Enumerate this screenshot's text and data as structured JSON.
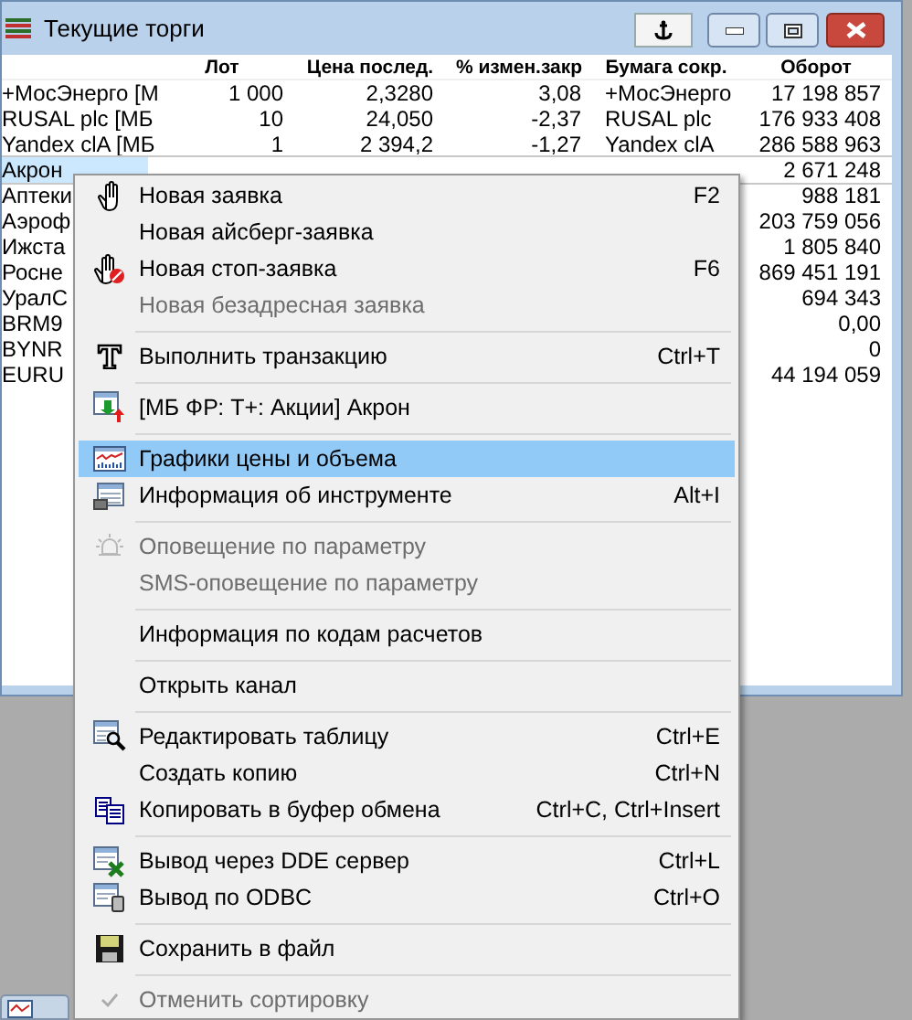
{
  "window": {
    "title": "Текущие торги"
  },
  "table": {
    "columns": [
      "",
      "Лот",
      "Цена послед.",
      "% измен.закр",
      "Бумага сокр.",
      "Оборот"
    ],
    "rows": [
      {
        "selected": false,
        "cells": [
          "+МосЭнерго [М",
          "1 000",
          "2,3280",
          "3,08",
          "+МосЭнерго",
          "17 198 857"
        ]
      },
      {
        "selected": false,
        "cells": [
          "RUSAL plc [МБ ",
          "10",
          "24,050",
          "-2,37",
          "RUSAL plc",
          "176 933 408"
        ]
      },
      {
        "selected": false,
        "cells": [
          "Yandex clA [МБ",
          "1",
          "2 394,2",
          "-1,27",
          "Yandex clA",
          "286 588 963"
        ]
      },
      {
        "selected": true,
        "cells": [
          "Акрон",
          "",
          "",
          "",
          "",
          "2 671 248"
        ]
      },
      {
        "selected": false,
        "cells": [
          "Аптеки",
          "",
          "",
          "",
          "",
          "988 181"
        ]
      },
      {
        "selected": false,
        "cells": [
          "Аэроф",
          "",
          "",
          "",
          "",
          "203 759 056"
        ]
      },
      {
        "selected": false,
        "cells": [
          "Ижста",
          "",
          "",
          "",
          "",
          "1 805 840"
        ]
      },
      {
        "selected": false,
        "cells": [
          "Росне",
          "",
          "",
          "",
          "",
          "869 451 191"
        ]
      },
      {
        "selected": false,
        "cells": [
          "УралС",
          "",
          "",
          "",
          "",
          "694 343"
        ]
      },
      {
        "selected": false,
        "cells": [
          "BRM9",
          "",
          "",
          "",
          "",
          "0,00"
        ]
      },
      {
        "selected": false,
        "cells": [
          "BYNR",
          "",
          "",
          "",
          "",
          "0"
        ]
      },
      {
        "selected": false,
        "cells": [
          "EURU",
          "",
          "",
          "",
          "",
          "44 194 059"
        ]
      }
    ]
  },
  "menu": {
    "items": [
      {
        "kind": "command",
        "label": "Новая заявка",
        "shortcut": "F2",
        "disabled": false,
        "selected": false
      },
      {
        "kind": "command",
        "label": "Новая айсберг-заявка",
        "disabled": false,
        "selected": false
      },
      {
        "kind": "command",
        "label": "Новая стоп-заявка",
        "shortcut": "F6",
        "disabled": false,
        "selected": false
      },
      {
        "kind": "command",
        "label": "Новая безадресная заявка",
        "disabled": true,
        "selected": false
      },
      {
        "kind": "separator"
      },
      {
        "kind": "command",
        "label": "Выполнить транзакцию",
        "shortcut": "Ctrl+T",
        "disabled": false,
        "selected": false
      },
      {
        "kind": "separator"
      },
      {
        "kind": "command",
        "label": "[МБ ФР: Т+: Акции] Акрон",
        "disabled": false,
        "selected": false
      },
      {
        "kind": "separator"
      },
      {
        "kind": "command",
        "label": "Графики цены и объема",
        "disabled": false,
        "selected": true
      },
      {
        "kind": "command",
        "label": "Информация об инструменте",
        "shortcut": "Alt+I",
        "disabled": false,
        "selected": false
      },
      {
        "kind": "separator"
      },
      {
        "kind": "command",
        "label": "Оповещение по параметру",
        "disabled": true,
        "selected": false
      },
      {
        "kind": "command",
        "label": "SMS-оповещение по параметру",
        "disabled": true,
        "selected": false
      },
      {
        "kind": "separator"
      },
      {
        "kind": "command",
        "label": "Информация по кодам расчетов",
        "disabled": false,
        "selected": false
      },
      {
        "kind": "separator"
      },
      {
        "kind": "command",
        "label": "Открыть канал",
        "disabled": false,
        "selected": false
      },
      {
        "kind": "separator"
      },
      {
        "kind": "command",
        "label": "Редактировать таблицу",
        "shortcut": "Ctrl+E",
        "disabled": false,
        "selected": false
      },
      {
        "kind": "command",
        "label": "Создать копию",
        "shortcut": "Ctrl+N",
        "disabled": false,
        "selected": false
      },
      {
        "kind": "command",
        "label": "Копировать в буфер обмена",
        "shortcut": "Ctrl+C, Ctrl+Insert",
        "disabled": false,
        "selected": false
      },
      {
        "kind": "separator"
      },
      {
        "kind": "command",
        "label": "Вывод через DDE сервер",
        "shortcut": "Ctrl+L",
        "disabled": false,
        "selected": false
      },
      {
        "kind": "command",
        "label": "Вывод по ODBC",
        "shortcut": "Ctrl+O",
        "disabled": false,
        "selected": false
      },
      {
        "kind": "separator"
      },
      {
        "kind": "command",
        "label": "Сохранить в файл",
        "disabled": false,
        "selected": false
      },
      {
        "kind": "separator"
      },
      {
        "kind": "command",
        "label": "Отменить сортировку",
        "disabled": true,
        "selected": false,
        "checked": true
      }
    ]
  }
}
